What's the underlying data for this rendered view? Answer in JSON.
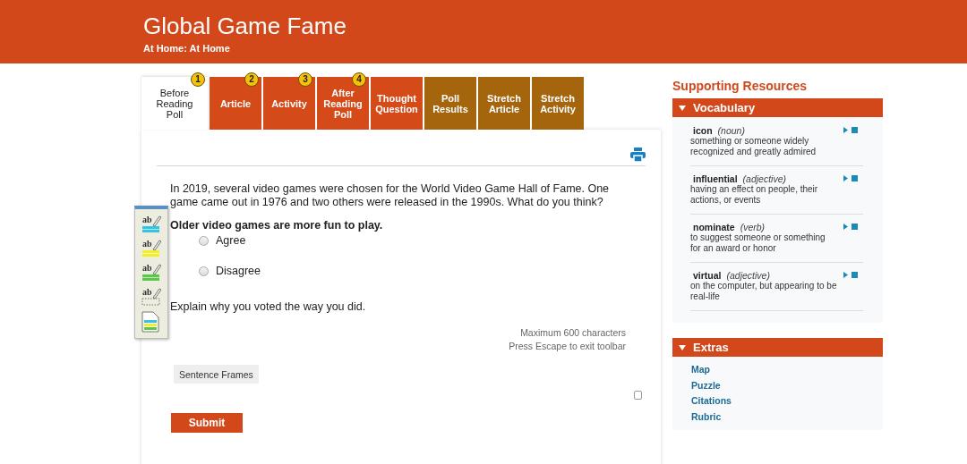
{
  "header": {
    "title": "Global Game Fame",
    "subtitle": "At Home: At Home"
  },
  "tabs": [
    {
      "label": "Before Reading Poll",
      "badge": "1",
      "selected": true
    },
    {
      "label": "Article",
      "badge": "2",
      "selected": false,
      "color": "#d44a18"
    },
    {
      "label": "Activity",
      "badge": "3",
      "selected": false,
      "color": "#d44a18"
    },
    {
      "label": "After Reading Poll",
      "badge": "4",
      "selected": false,
      "color": "#d44a18"
    },
    {
      "label": "Thought Question",
      "selected": false,
      "color": "#d44a18"
    },
    {
      "label": "Poll Results",
      "selected": false,
      "color": "#a4650d"
    },
    {
      "label": "Stretch Article",
      "selected": false,
      "color": "#a4650d"
    },
    {
      "label": "Stretch Activity",
      "selected": false,
      "color": "#a4650d"
    }
  ],
  "toolbar": [
    {
      "kind": "highlight",
      "label": "ab",
      "color": "#35c3e3"
    },
    {
      "kind": "highlight",
      "label": "ab",
      "color": "#f2ee2a"
    },
    {
      "kind": "highlight",
      "label": "ab",
      "color": "#5cc84a"
    },
    {
      "kind": "clear",
      "label": "ab"
    },
    {
      "kind": "notes"
    }
  ],
  "poll": {
    "intro": "In 2019, several video games were chosen for the World Video Game Hall of Fame. One game came out in 1976 and two others were released in the 1990s. What do you think?",
    "question": "Older video games are more fun to play.",
    "options": [
      {
        "label": "Agree",
        "selected": false
      },
      {
        "label": "Disagree",
        "selected": false
      }
    ],
    "prompt": "Explain why you voted the way you did.",
    "limit": "Maximum 600 characters",
    "hint": "Press Escape to exit toolbar",
    "frames_button": "Sentence Frames",
    "checkbox": {
      "checked": false
    },
    "submit": "Submit"
  },
  "sidebar": {
    "title": "Supporting Resources",
    "vocabulary": {
      "title": "Vocabulary",
      "expanded": true,
      "items": [
        {
          "word": "icon",
          "pos": "(noun)",
          "definition": "something or someone widely recognized and greatly admired"
        },
        {
          "word": "influential",
          "pos": "(adjective)",
          "definition": "having an effect on people, their actions, or events"
        },
        {
          "word": "nominate",
          "pos": "(verb)",
          "definition": "to suggest someone or something for an award or honor"
        },
        {
          "word": "virtual",
          "pos": "(adjective)",
          "definition": "on the computer, but appearing to be real-life"
        }
      ]
    },
    "extras": {
      "title": "Extras",
      "expanded": true,
      "links": [
        "Map",
        "Puzzle",
        "Citations",
        "Rubric"
      ]
    }
  }
}
